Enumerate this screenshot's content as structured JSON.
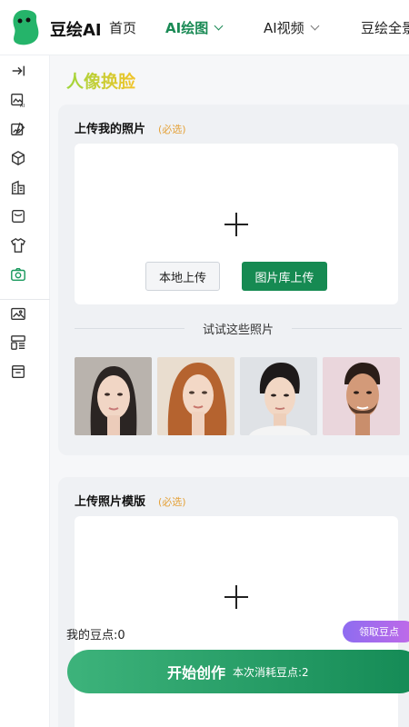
{
  "header": {
    "brand": "豆绘AI",
    "nav": [
      {
        "label": "首页"
      },
      {
        "label": "AI绘图"
      },
      {
        "label": "AI视频"
      },
      {
        "label": "豆绘全景"
      }
    ]
  },
  "sidebar": {
    "items": [
      "collapse-icon",
      "ai-image-icon",
      "edit-image-icon",
      "cube-icon",
      "building-icon",
      "bag-icon",
      "shirt-icon",
      "camera-icon",
      "gallery-icon",
      "layout-icon",
      "archive-icon"
    ],
    "active": "camera-icon"
  },
  "page": {
    "title": "人像换脸"
  },
  "upload_photo": {
    "title": "上传我的照片",
    "required": "(必选)",
    "local_button": "本地上传",
    "library_button": "图片库上传",
    "try_label": "试试这些照片"
  },
  "upload_template": {
    "title": "上传照片模版",
    "required": "(必选)"
  },
  "footer": {
    "beans": "我的豆点:0",
    "get_beans": "领取豆点",
    "start": "开始创作",
    "cost": "本次消耗豆点:2"
  },
  "colors": {
    "accent": "#168a52",
    "required": "#e4a23a",
    "title_gradient": [
      "#9fd63c",
      "#f2c42b"
    ]
  }
}
